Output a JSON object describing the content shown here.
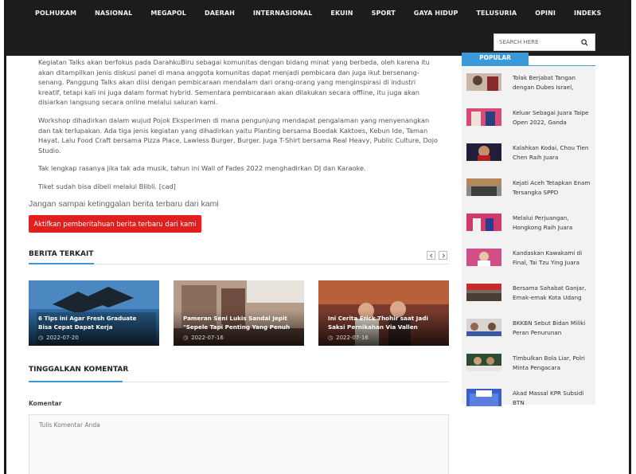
{
  "nav": {
    "items": [
      "POLHUKAM",
      "NASIONAL",
      "MEGAPOL",
      "DAERAH",
      "INTERNASIONAL",
      "EKUIN",
      "SPORT",
      "GAYA HIDUP",
      "TELUSURIA",
      "OPINI",
      "INDEKS"
    ],
    "search_placeholder": "SEARCH HERE"
  },
  "article": {
    "paragraphs": [
      "Kegiatan Talks akan berfokus pada DarahkuBiru sebagai komunitas dengan bidang minat yang berbeda, oleh karena itu akan ditampilkan jenis diskusi panel di mana anggota komunitas dapat menjadi pembicara dan juga ikut bersenang-senang. Panggung Talks akan diisi dengan pembicaraan mendalam dari orang-orang yang menginspirasi di industri kreatif, tetapi kali ini juga dalam format hybrid. Sementara pembicaraan akan dilakukan secara offline, itu juga akan disiarkan langsung secara online melalui saluran kami.",
      "Workshop dihadirkan dalam wujud Pojok Eksperimen di mana pengunjung mendapat pengalaman yang menyenangkan dan tak terlupakan. Ada tiga jenis kegiatan yang dihadirkan yaitu Planting bersama Boedak Kaktoes, Kebun Ide, Taman Hayat. Lalu Food Craft bersama Pizza Place, Lawless Burger, Burger. Juga T-Shirt bersama Real Heavy, Public Culture, Dojo Studio.",
      "Tak lengkap rasanya jika tak ada musik, tahun ini Wall of Fades 2022 menghadirkan DJ dan Karaoke.",
      "Tiket sudah bisa dibeli melalui Blibli. [cad]"
    ]
  },
  "notify": {
    "reminder": "Jangan sampai ketinggalan berita terbaru dari kami",
    "button": "Aktifkan pemberitahuan berita terbaru dari kami"
  },
  "related": {
    "title": "BERITA TERKAIT",
    "items": [
      {
        "title": "6 Tips ini Agar Fresh Graduate Bisa Cepat Dapat Kerja",
        "date": "2022-07-20"
      },
      {
        "title": "Pameran Seni Lukis Sandal Jepit \"Sepele Tapi Penting Yang Penuh",
        "date": "2022-07-16"
      },
      {
        "title": "Ini Cerita Erick Thohir saat Jadi Saksi Pernikahan Via Vallen",
        "date": "2022-07-16"
      }
    ]
  },
  "comment": {
    "section_title": "TINGGALKAN KOMENTAR",
    "label": "Komentar",
    "placeholder": "Tulis Komentar Anda"
  },
  "sidebar": {
    "tab": "POPULAR",
    "items": [
      {
        "title": "Tolak Berjabat Tangan dengan Dubes Israel,"
      },
      {
        "title": "Keluar Sebagai Juara Taipe Open 2022, Ganda"
      },
      {
        "title": "Kalahkan Kodai, Chou Tien Chen Raih Juara"
      },
      {
        "title": "Kejati Aceh Tetapkan Enam Tersangka SPPD"
      },
      {
        "title": "Melalui Perjuangan, Hongkong Raih Juara"
      },
      {
        "title": "Kandaskan Kawakami di Final, Tai Tzu Ying Juara"
      },
      {
        "title": "Bersama Sahabat Ganjar, Emak-emak Kota Udang"
      },
      {
        "title": "BKKBN Sebut Bidan Miliki Peran Penurunan"
      },
      {
        "title": "Timbulkan Bola Liar, Polri Minta Pengacara"
      },
      {
        "title": "Akad Massal KPR Subsidi BTN"
      }
    ]
  },
  "colors": {
    "nav_bg": "#1c1c1c",
    "accent": "#3a9ad9",
    "button_red": "#e01f1f"
  }
}
